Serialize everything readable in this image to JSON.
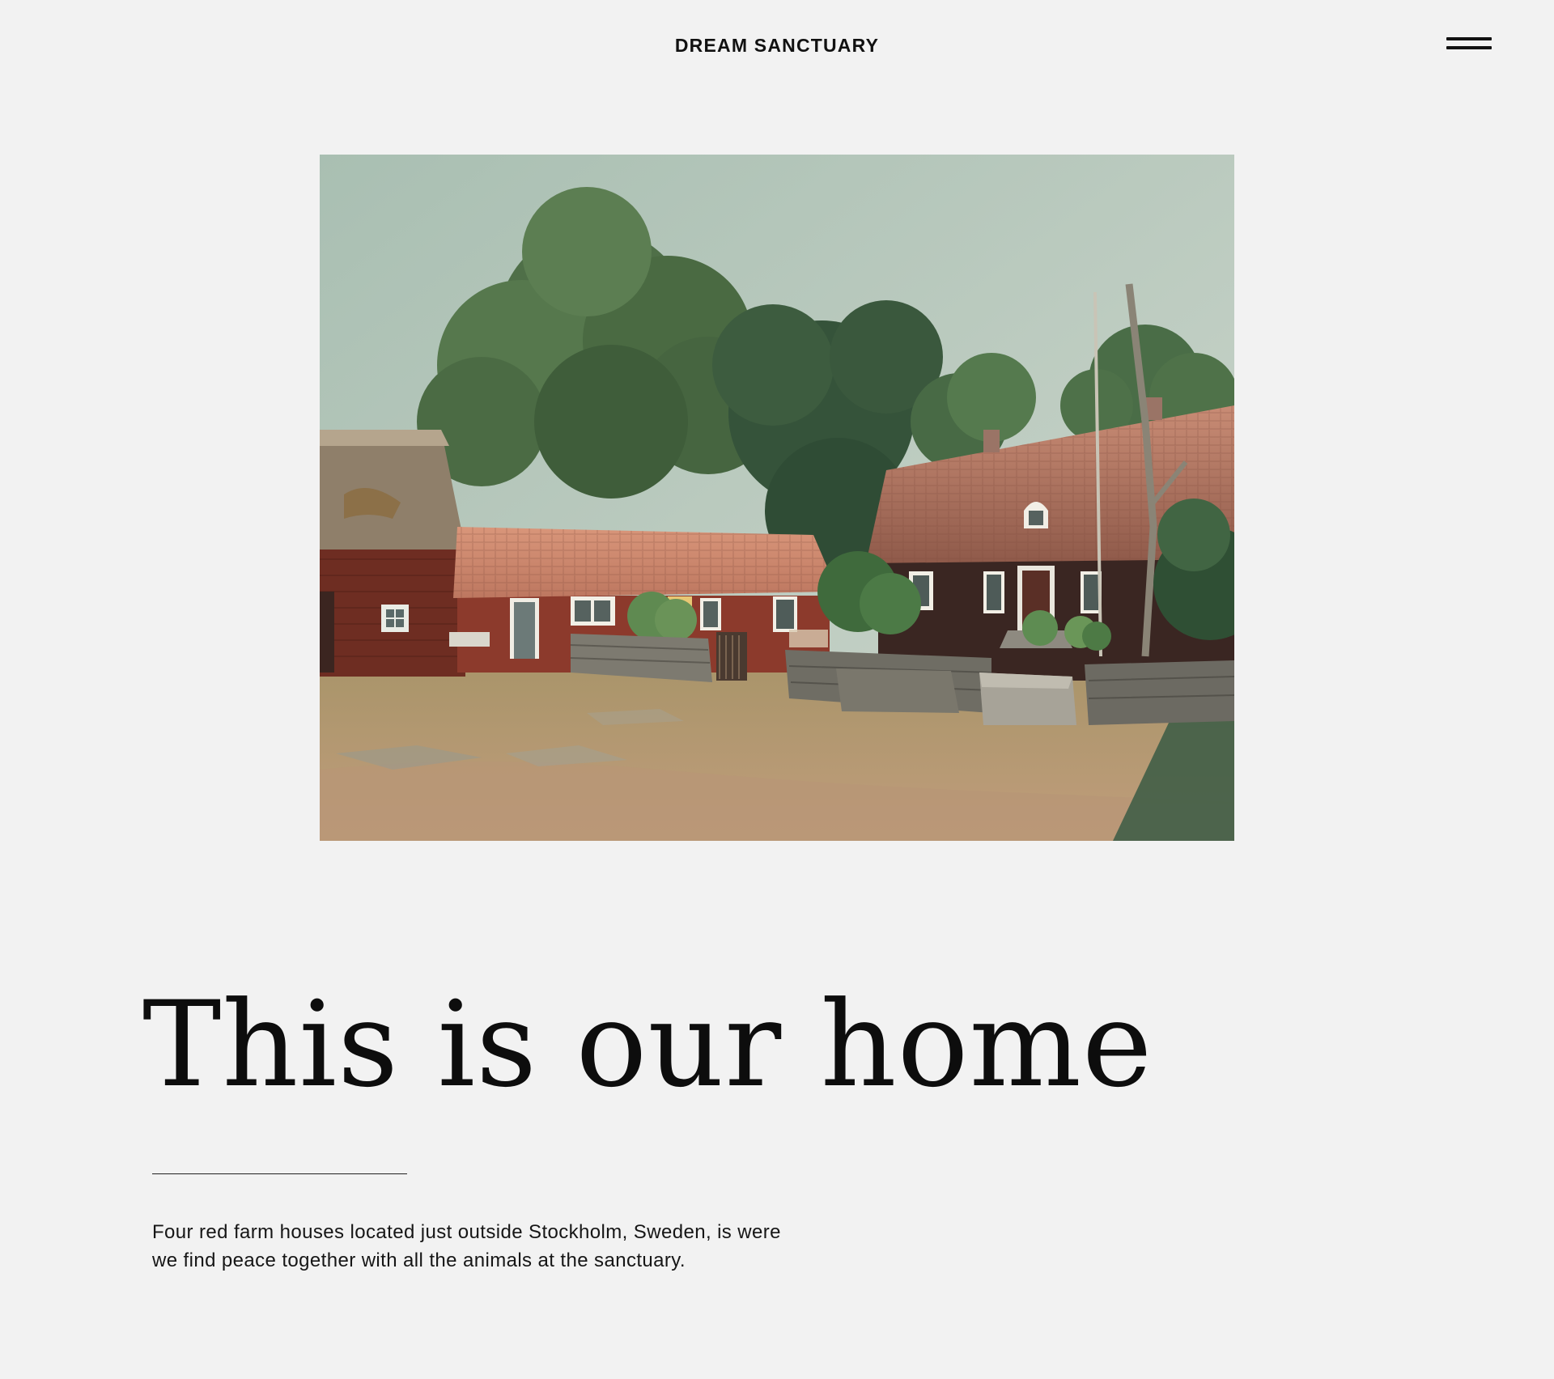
{
  "header": {
    "site_title": "DREAM SANCTUARY",
    "menu_icon": "hamburger-menu-icon"
  },
  "hero": {
    "image_alt": "Red wooden farm houses with tiled and thatched roofs among large green trees and a stone wall courtyard"
  },
  "intro": {
    "headline": "This is our home",
    "description_line_1": "Four red farm houses located just outside Stockholm, Sweden, is were",
    "description_line_2": "we find peace together with all the animals at the sanctuary."
  },
  "colors": {
    "page_background": "#f2f2f2",
    "text": "#111111",
    "accent_house_red": "#7a3226",
    "roof_terracotta": "#c4795f"
  }
}
